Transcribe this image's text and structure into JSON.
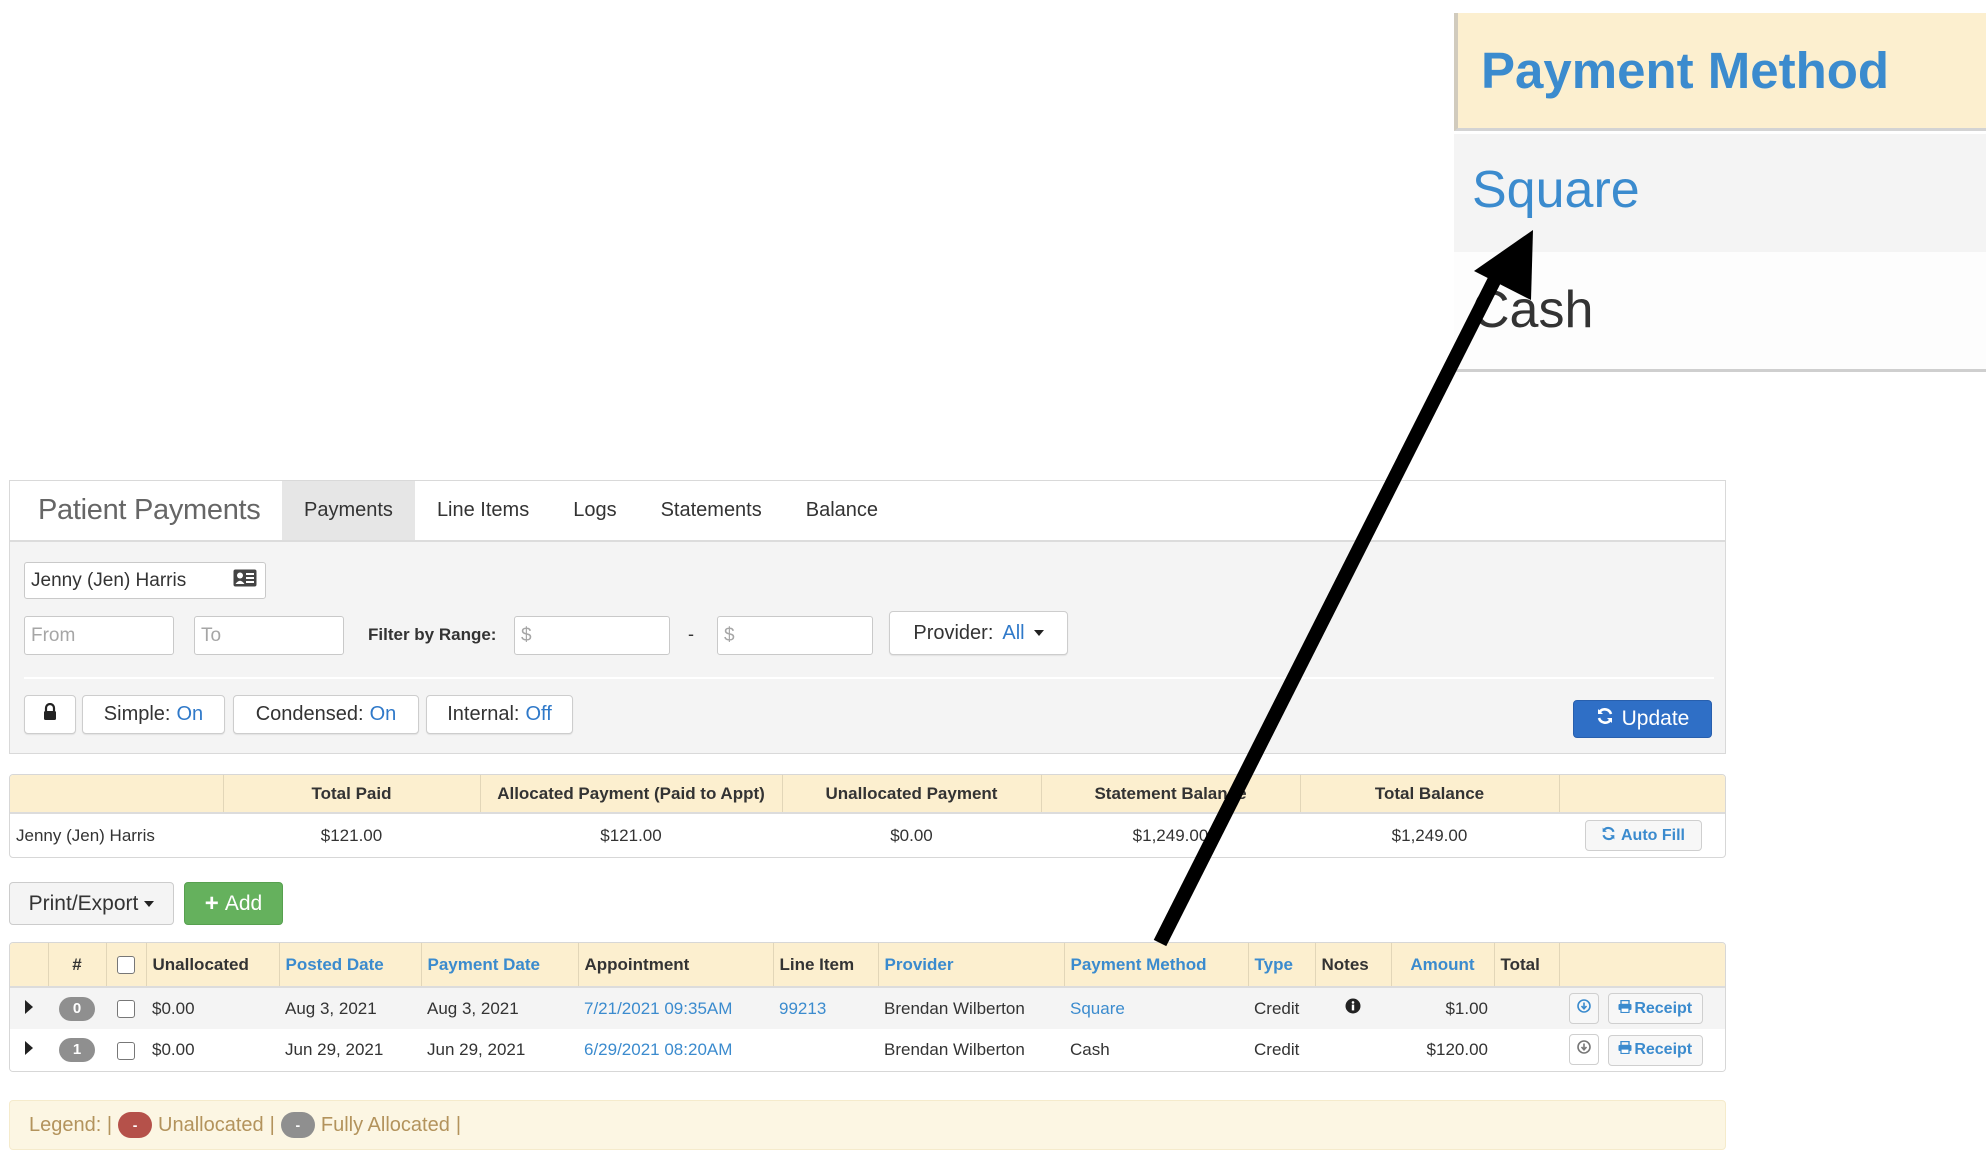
{
  "callout": {
    "header": "Payment Method",
    "rows": [
      "Square",
      "Cash"
    ]
  },
  "app": {
    "title": "Patient Payments",
    "tabs": [
      {
        "label": "Payments",
        "active": true
      },
      {
        "label": "Line Items",
        "active": false
      },
      {
        "label": "Logs",
        "active": false
      },
      {
        "label": "Statements",
        "active": false
      },
      {
        "label": "Balance",
        "active": false
      }
    ]
  },
  "filters": {
    "patient": "Jenny (Jen) Harris",
    "from_placeholder": "From",
    "to_placeholder": "To",
    "range_label": "Filter by Range:",
    "range_min_placeholder": "$",
    "range_sep": "-",
    "range_max_placeholder": "$",
    "provider_label": "Provider:",
    "provider_value": "All",
    "toggles": [
      {
        "label": "Simple:",
        "value": "On"
      },
      {
        "label": "Condensed:",
        "value": "On"
      },
      {
        "label": "Internal:",
        "value": "Off"
      }
    ],
    "update_label": "Update"
  },
  "summary": {
    "headers": [
      "",
      "Total Paid",
      "Allocated Payment (Paid to Appt)",
      "Unallocated Payment",
      "Statement Balance",
      "Total Balance",
      ""
    ],
    "row": {
      "name": "Jenny (Jen) Harris",
      "total_paid": "$121.00",
      "allocated": "$121.00",
      "unallocated": "$0.00",
      "statement_balance": "$1,249.00",
      "total_balance": "$1,249.00"
    },
    "autofill_label": "Auto Fill"
  },
  "actions": {
    "print_export": "Print/Export",
    "add": "Add"
  },
  "payments": {
    "headers": {
      "num": "#",
      "unallocated": "Unallocated",
      "posted_date": "Posted Date",
      "payment_date": "Payment Date",
      "appointment": "Appointment",
      "line_item": "Line Item",
      "provider": "Provider",
      "payment_method": "Payment Method",
      "type": "Type",
      "notes": "Notes",
      "amount": "Amount",
      "total": "Total"
    },
    "rows": [
      {
        "index": "0",
        "unallocated": "$0.00",
        "posted_date": "Aug 3, 2021",
        "payment_date": "Aug 3, 2021",
        "appointment": "7/21/2021 09:35AM",
        "line_item": "99213",
        "provider": "Brendan Wilberton",
        "payment_method": "Square",
        "type": "Credit",
        "amount": "$1.00",
        "total": "",
        "receipt": "Receipt"
      },
      {
        "index": "1",
        "unallocated": "$0.00",
        "posted_date": "Jun 29, 2021",
        "payment_date": "Jun 29, 2021",
        "appointment": "6/29/2021 08:20AM",
        "line_item": "",
        "provider": "Brendan Wilberton",
        "payment_method": "Cash",
        "type": "Credit",
        "amount": "$120.00",
        "total": "",
        "receipt": "Receipt"
      }
    ]
  },
  "legend": {
    "label": "Legend: |",
    "items": [
      {
        "symbol": "-",
        "label": "Unallocated",
        "color": "#b5514a"
      },
      {
        "symbol": "-",
        "label": "Fully Allocated",
        "color": "#8f8f8f"
      }
    ],
    "sep": "|"
  },
  "colors": {
    "accent": "#3b8bce",
    "primary": "#2f6fc6",
    "success": "#65b15d",
    "header_bg": "#fcefcf"
  }
}
